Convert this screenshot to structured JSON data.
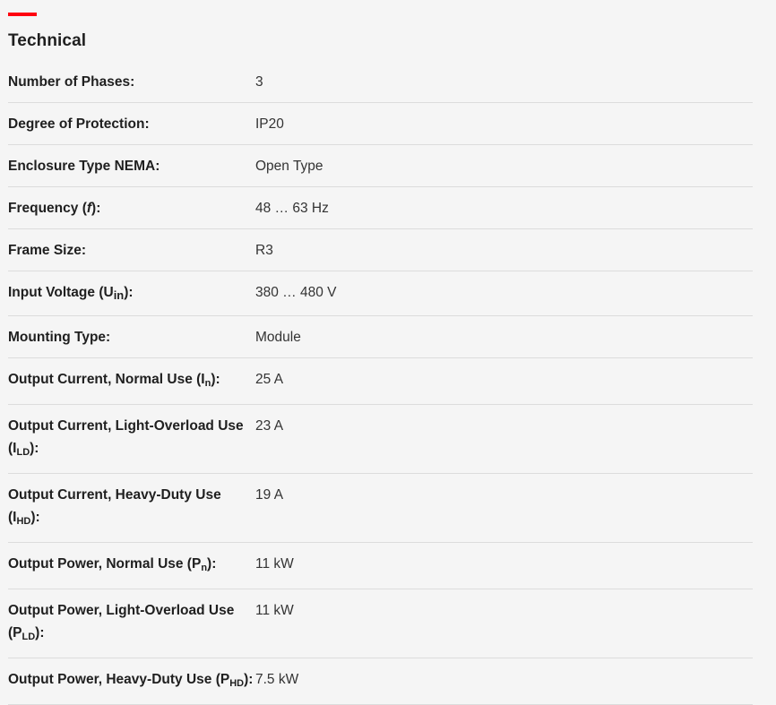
{
  "section": {
    "title": "Technical",
    "accent_color": "#ff000f"
  },
  "rows": [
    {
      "label": "Number of Phases:",
      "value": "3"
    },
    {
      "label": "Degree of Protection:",
      "value": "IP20"
    },
    {
      "label": "Enclosure Type NEMA:",
      "value": "Open Type"
    },
    {
      "label_pre": "Frequency (",
      "label_sym": "f",
      "label_post": "):",
      "value": "48 … 63 Hz"
    },
    {
      "label": "Frame Size:",
      "value": "R3"
    },
    {
      "label_pre": "Input Voltage (U",
      "label_sub": "in",
      "label_post": "):",
      "value": "380 … 480 V"
    },
    {
      "label": "Mounting Type:",
      "value": "Module"
    },
    {
      "label_pre": "Output Current, Normal Use (I",
      "label_sub": "n",
      "label_post": "):",
      "value": "25 A"
    },
    {
      "label_pre": "Output Current, Light-Overload Use (I",
      "label_sub": "LD",
      "label_post": "):",
      "value": "23 A"
    },
    {
      "label_pre": "Output Current, Heavy-Duty Use (I",
      "label_sub": "HD",
      "label_post": "):",
      "value": "19 A"
    },
    {
      "label_pre": "Output Power, Normal Use (P",
      "label_sub": "n",
      "label_post": "):",
      "value": "11 kW"
    },
    {
      "label_pre": "Output Power, Light-Overload Use (P",
      "label_sub": "LD",
      "label_post": "):",
      "value": "11 kW"
    },
    {
      "label_pre": "Output Power, Heavy-Duty Use (P",
      "label_sub": "HD",
      "label_post": "):",
      "value": "7.5 kW"
    }
  ]
}
